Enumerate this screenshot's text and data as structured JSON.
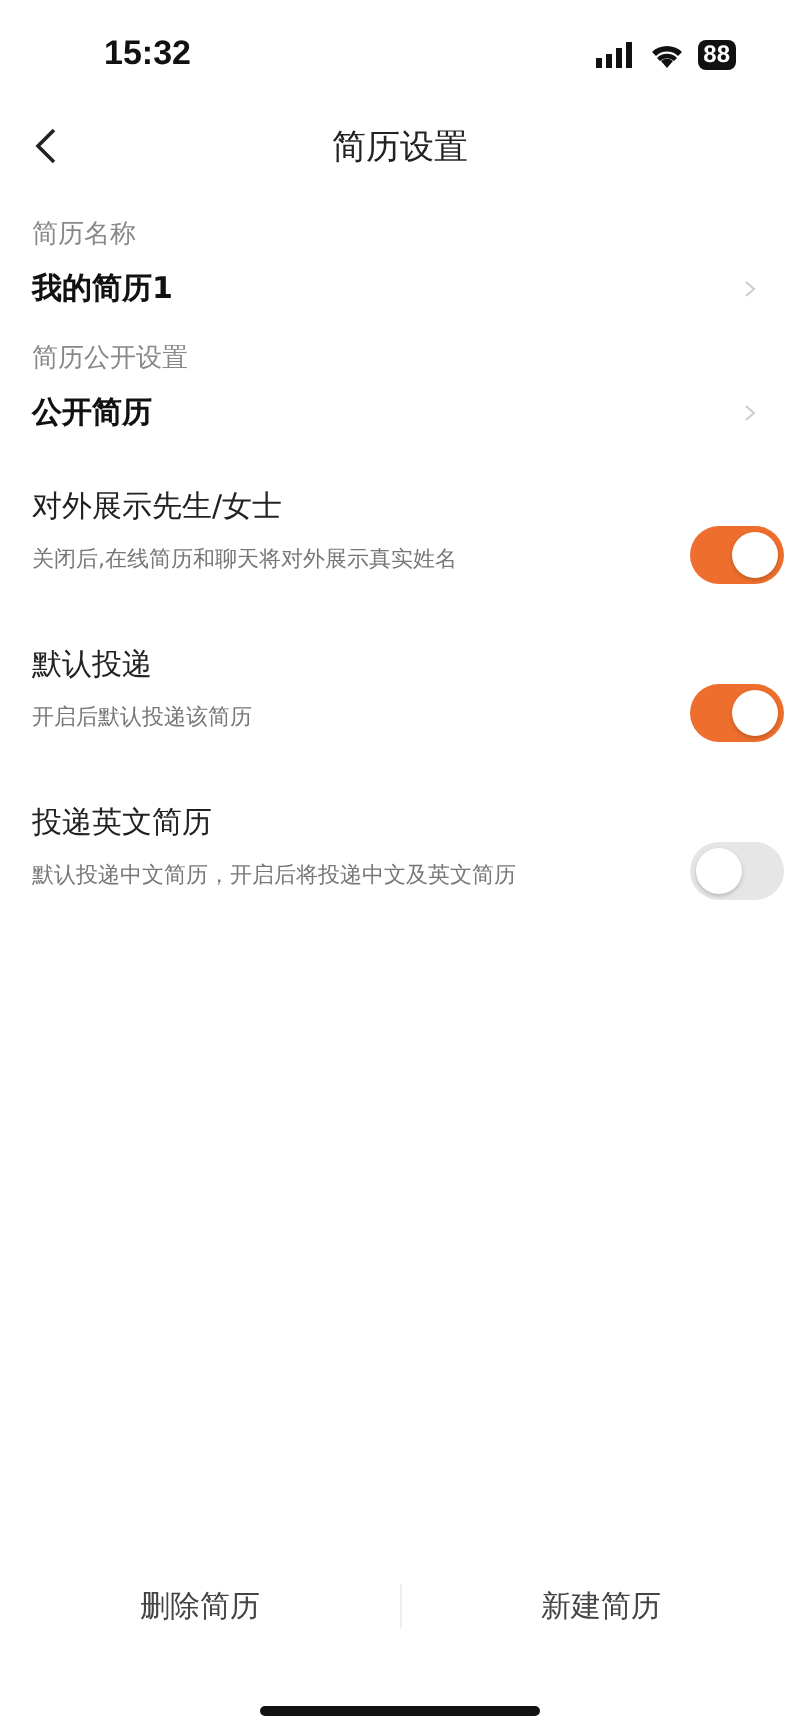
{
  "status_bar": {
    "time": "15:32",
    "battery": "88"
  },
  "nav": {
    "title": "简历设置"
  },
  "fields": [
    {
      "label": "简历名称",
      "value": "我的简历1"
    },
    {
      "label": "简历公开设置",
      "value": "公开简历"
    }
  ],
  "toggles": [
    {
      "title": "对外展示先生/女士",
      "description": "关闭后,在线简历和聊天将对外展示真实姓名",
      "on": true
    },
    {
      "title": "默认投递",
      "description": "开启后默认投递该简历",
      "on": true
    },
    {
      "title": "投递英文简历",
      "description": "默认投递中文简历，开启后将投递中文及英文简历",
      "on": false
    }
  ],
  "actions": [
    "删除简历",
    "新建简历"
  ]
}
